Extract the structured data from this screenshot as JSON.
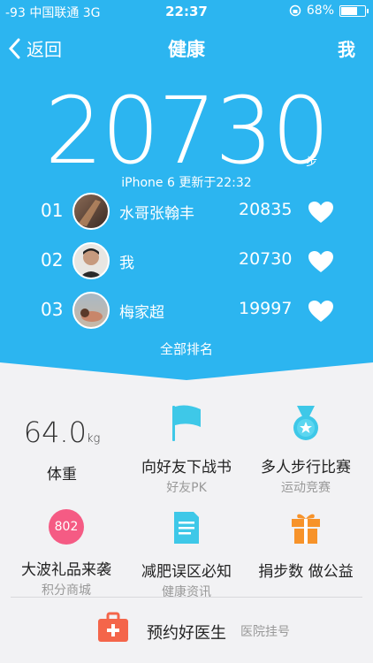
{
  "status_bar": {
    "signal": "-93 中国联通 3G",
    "time": "22:37",
    "battery": "68%"
  },
  "nav": {
    "back_label": "返回",
    "title": "健康",
    "me_label": "我"
  },
  "steps": {
    "count": "20730",
    "unit": "步",
    "device_updated": "iPhone 6 更新于22:32"
  },
  "ranking": [
    {
      "pos": "01",
      "name": "水哥张翰丰",
      "score": "20835"
    },
    {
      "pos": "02",
      "name": "我",
      "score": "20730"
    },
    {
      "pos": "03",
      "name": "梅家超",
      "score": "19997"
    }
  ],
  "all_ranking_label": "全部排名",
  "weight": {
    "value": "64.0",
    "unit": "kg",
    "label": "体重"
  },
  "features": {
    "challenge": {
      "title": "向好友下战书",
      "subtitle": "好友PK"
    },
    "multi_walk": {
      "title": "多人步行比赛",
      "subtitle": "运动竞赛"
    },
    "gift": {
      "badge": "802",
      "title": "大波礼品来袭",
      "subtitle": "积分商城"
    },
    "diet": {
      "title": "减肥误区必知",
      "subtitle": "健康资讯"
    },
    "donate": {
      "title": "捐步数 做公益"
    }
  },
  "doctor": {
    "title": "预约好医生",
    "subtitle": "医院挂号"
  },
  "colors": {
    "hero_blue": "#2cb5f0",
    "gift_pink": "#f55b84",
    "orange": "#f7932a",
    "teal": "#3ec8e8"
  }
}
